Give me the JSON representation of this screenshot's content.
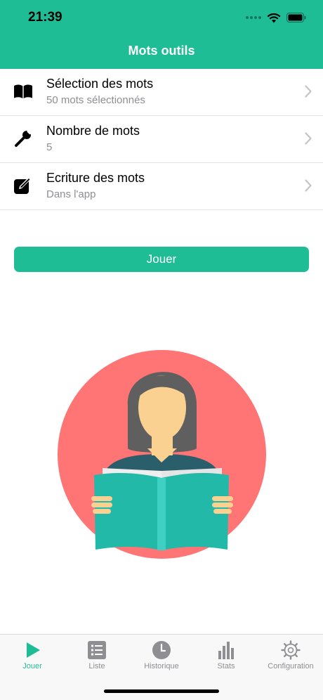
{
  "status_bar": {
    "time": "21:39"
  },
  "header": {
    "title": "Mots outils"
  },
  "settings": [
    {
      "title": "Sélection des mots",
      "subtitle": "50 mots sélectionnés",
      "icon": "book-icon"
    },
    {
      "title": "Nombre de mots",
      "subtitle": "5",
      "icon": "wrench-icon"
    },
    {
      "title": "Ecriture des mots",
      "subtitle": "Dans l'app",
      "icon": "edit-icon"
    }
  ],
  "play_button": {
    "label": "Jouer"
  },
  "tabs": [
    {
      "label": "Jouer",
      "icon": "play-icon",
      "active": true
    },
    {
      "label": "Liste",
      "icon": "list-icon",
      "active": false
    },
    {
      "label": "Historique",
      "icon": "clock-icon",
      "active": false
    },
    {
      "label": "Stats",
      "icon": "bar-chart-icon",
      "active": false
    },
    {
      "label": "Configuration",
      "icon": "gear-icon",
      "active": false
    }
  ],
  "colors": {
    "accent": "#1fbd96",
    "circle": "#ff7576",
    "book": "#22b9a8",
    "tab_inactive": "#8e8e93"
  }
}
